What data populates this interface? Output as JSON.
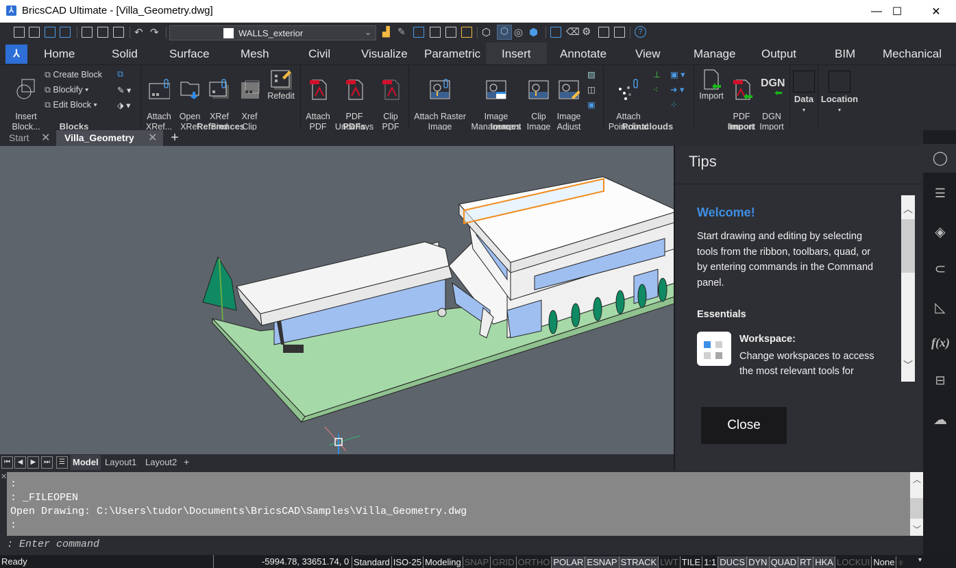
{
  "window": {
    "app_title": "BricsCAD Ultimate  - [Villa_Geometry.dwg]",
    "minimize": "—",
    "maximize": "☐",
    "close": "✕"
  },
  "qat": {
    "current_layer": "WALLS_exterior"
  },
  "ribbon_tabs": [
    "Home",
    "Solid",
    "Surface",
    "Mesh",
    "Civil",
    "Visualize",
    "Parametric",
    "Insert",
    "Annotate",
    "View",
    "Manage",
    "Output",
    "BIM",
    "Mechanical"
  ],
  "active_tab": "Insert",
  "ribbon": {
    "blocks": {
      "label": "Blocks",
      "insert_block": "Insert\nBlock...",
      "create_block": "Create Block",
      "blockify": "Blockify",
      "edit_block": "Edit Block"
    },
    "references": {
      "label": "References",
      "attach_xref": "Attach\nXRef...",
      "open_xref": "Open\nXRef",
      "xref_bind": "XRef\nBind",
      "xref_clip": "Xref\nClip",
      "refedit": "Refedit"
    },
    "pdfs": {
      "label": "PDFs",
      "attach_pdf": "Attach\nPDF",
      "pdf_underlays": "PDF\nUnderlays",
      "clip_pdf": "Clip\nPDF"
    },
    "images": {
      "label": "Images",
      "attach_raster": "Attach Raster\nImage",
      "image_management": "Image\nManagement",
      "clip_image": "Clip\nImage",
      "image_adjust": "Image\nAdjust"
    },
    "pointclouds": {
      "label": "Pointclouds",
      "attach_pointcloud": "Attach\nPointcloud"
    },
    "import": {
      "label": "Import",
      "import": "Import",
      "pdf_import": "PDF\nImport",
      "dgn_import": "DGN\nImport",
      "dgn_glyph": "DGN"
    },
    "data": "Data",
    "location": "Location"
  },
  "doc_tabs": [
    {
      "label": "Start"
    },
    {
      "label": "Villa_Geometry",
      "active": true
    }
  ],
  "layout_tabs": [
    "Model",
    "Layout1",
    "Layout2",
    "+"
  ],
  "tips": {
    "title": "Tips",
    "welcome": "Welcome!",
    "body": "Start drawing and editing by selecting tools from the ribbon, toolbars, quad, or by entering commands in the Command panel.",
    "essentials": "Essentials",
    "workspace_title": "Workspace:",
    "workspace_desc": "Change workspaces to access the most relevant tools for",
    "close": "Close"
  },
  "command": {
    "history": [
      ":",
      ": _FILEOPEN",
      "Open Drawing: C:\\Users\\tudor\\Documents\\BricsCAD\\Samples\\Villa_Geometry.dwg",
      ":"
    ],
    "placeholder": ": Enter command"
  },
  "status": {
    "ready": "Ready",
    "coords": "-5994.78, 33651.74, 0",
    "items": [
      {
        "label": "Standard",
        "state": "plain"
      },
      {
        "label": "ISO-25",
        "state": "plain"
      },
      {
        "label": "Modeling",
        "state": "plain"
      },
      {
        "label": "SNAP",
        "state": "off"
      },
      {
        "label": "GRID",
        "state": "off"
      },
      {
        "label": "ORTHO",
        "state": "off"
      },
      {
        "label": "POLAR",
        "state": "on"
      },
      {
        "label": "ESNAP",
        "state": "on"
      },
      {
        "label": "STRACK",
        "state": "on"
      },
      {
        "label": "LWT",
        "state": "off"
      },
      {
        "label": "TILE",
        "state": "plain"
      },
      {
        "label": "1:1",
        "state": "plain"
      },
      {
        "label": "DUCS",
        "state": "on"
      },
      {
        "label": "DYN",
        "state": "on"
      },
      {
        "label": "QUAD",
        "state": "on"
      },
      {
        "label": "RT",
        "state": "on"
      },
      {
        "label": "HKA",
        "state": "on"
      },
      {
        "label": "LOCKUI",
        "state": "off"
      },
      {
        "label": "None",
        "state": "plain"
      }
    ]
  },
  "colors": {
    "accent": "#2d6fd6",
    "welcome": "#3d8fe6",
    "selection": "#f28c1c",
    "lawn": "#a6d9a8",
    "glass": "#9fbff0",
    "tree": "#0f8a63"
  }
}
